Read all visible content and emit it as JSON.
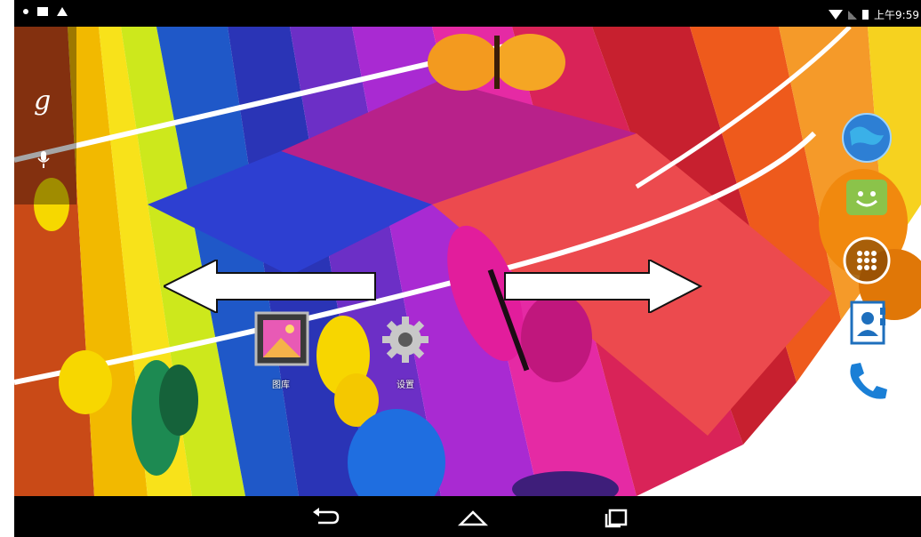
{
  "status_bar": {
    "time": "上午9:59",
    "notification_icons": [
      "dot-icon",
      "screenshot-icon",
      "warning-icon"
    ],
    "system_icons": [
      "wifi-icon",
      "signal-icon",
      "battery-icon"
    ]
  },
  "home": {
    "search": {
      "icon": "google-g-icon",
      "letter": "g",
      "mic": "mic-icon"
    },
    "apps": [
      {
        "name": "gallery",
        "label": "图库"
      },
      {
        "name": "settings",
        "label": "设置"
      }
    ],
    "dock": [
      "browser-icon",
      "store-icon",
      "all-apps-icon",
      "contacts-icon",
      "phone-icon"
    ]
  },
  "gestures": {
    "arrows": [
      "swipe-left-arrow",
      "swipe-right-arrow"
    ]
  },
  "nav_bar": {
    "buttons": [
      "back-icon",
      "home-icon",
      "recent-apps-icon"
    ]
  },
  "colors": {
    "white": "#ffffff",
    "black": "#000000",
    "magenta": "#e52aa4",
    "blue": "#1f5fd6",
    "yellow": "#f5d400",
    "red": "#e8433f"
  }
}
